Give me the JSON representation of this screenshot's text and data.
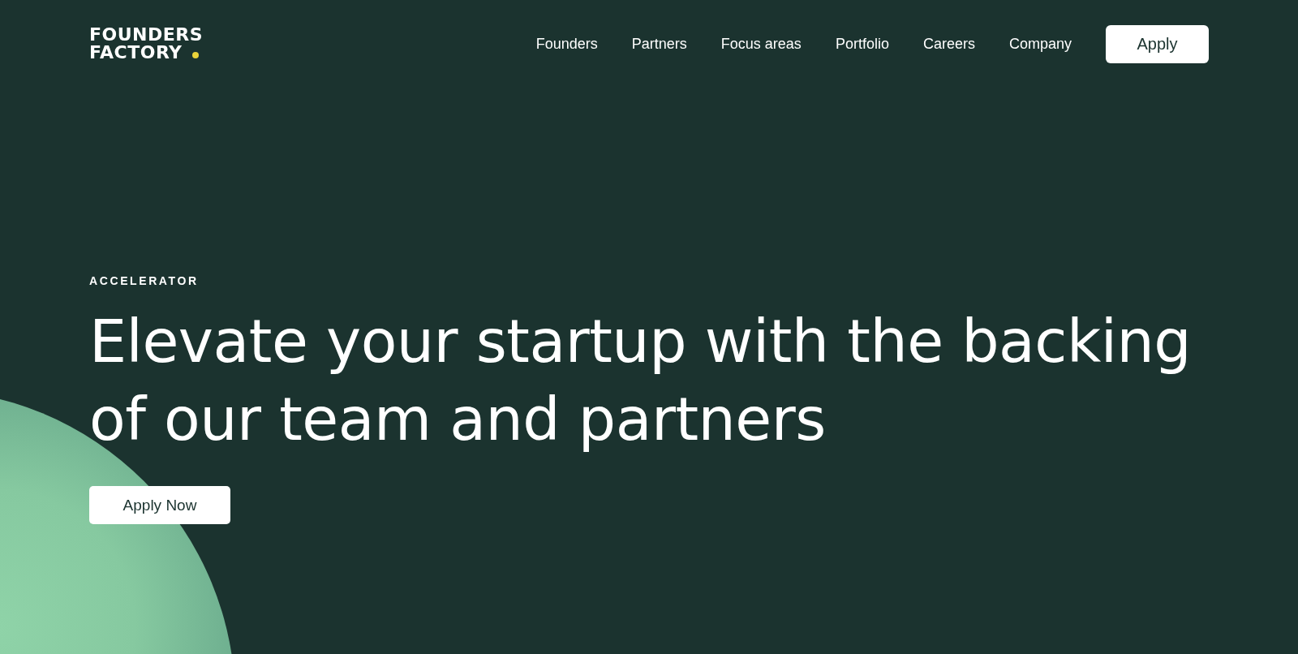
{
  "logo": {
    "lines": [
      "FOUNDERS",
      "FACTORY"
    ]
  },
  "nav": {
    "links": [
      "Founders",
      "Partners",
      "Focus areas",
      "Portfolio",
      "Careers",
      "Company"
    ],
    "cta": "Apply"
  },
  "hero": {
    "eyebrow": "ACCELERATOR",
    "headline": "Elevate your startup with the backing of our team and partners",
    "button": "Apply Now"
  }
}
